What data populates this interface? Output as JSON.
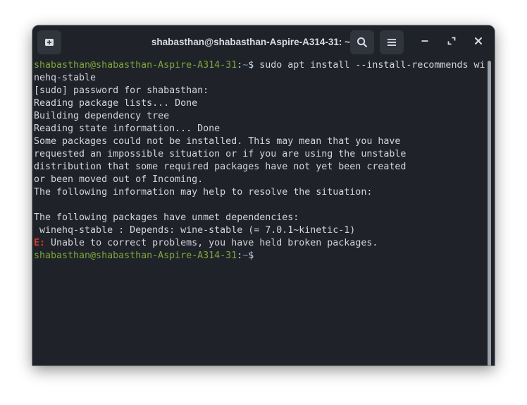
{
  "window": {
    "title": "shabasthan@shabasthan-Aspire-A314-31: ~"
  },
  "header": {
    "new_tab_icon": "new-tab-icon",
    "search_icon": "search-icon",
    "menu_icon": "hamburger-menu-icon",
    "minimize_icon": "minimize-icon",
    "maximize_icon": "maximize-icon",
    "close_icon": "close-icon"
  },
  "colors": {
    "background": "#1f2329",
    "button_bg": "#30353d",
    "prompt_user": "#7fa63b",
    "prompt_path": "#6f95c9",
    "error": "#d33b2f",
    "text": "#d2d6dc"
  },
  "terminal": {
    "prompt_user": "shabasthan@shabasthan-Aspire-A314-31",
    "prompt_colon": ":",
    "prompt_path": "~",
    "prompt_symbol": "$",
    "command_part1": " sudo apt install --install-recommends wi",
    "command_part2": "nehq-stable",
    "lines": [
      "[sudo] password for shabasthan:",
      "Reading package lists... Done",
      "Building dependency tree",
      "Reading state information... Done",
      "Some packages could not be installed. This may mean that you have",
      "requested an impossible situation or if you are using the unstable",
      "distribution that some required packages have not yet been created",
      "or been moved out of Incoming.",
      "The following information may help to resolve the situation:",
      "",
      "The following packages have unmet dependencies:",
      " winehq-stable : Depends: wine-stable (= 7.0.1~kinetic-1)"
    ],
    "error_prefix": "E:",
    "error_message": " Unable to correct problems, you have held broken packages."
  }
}
